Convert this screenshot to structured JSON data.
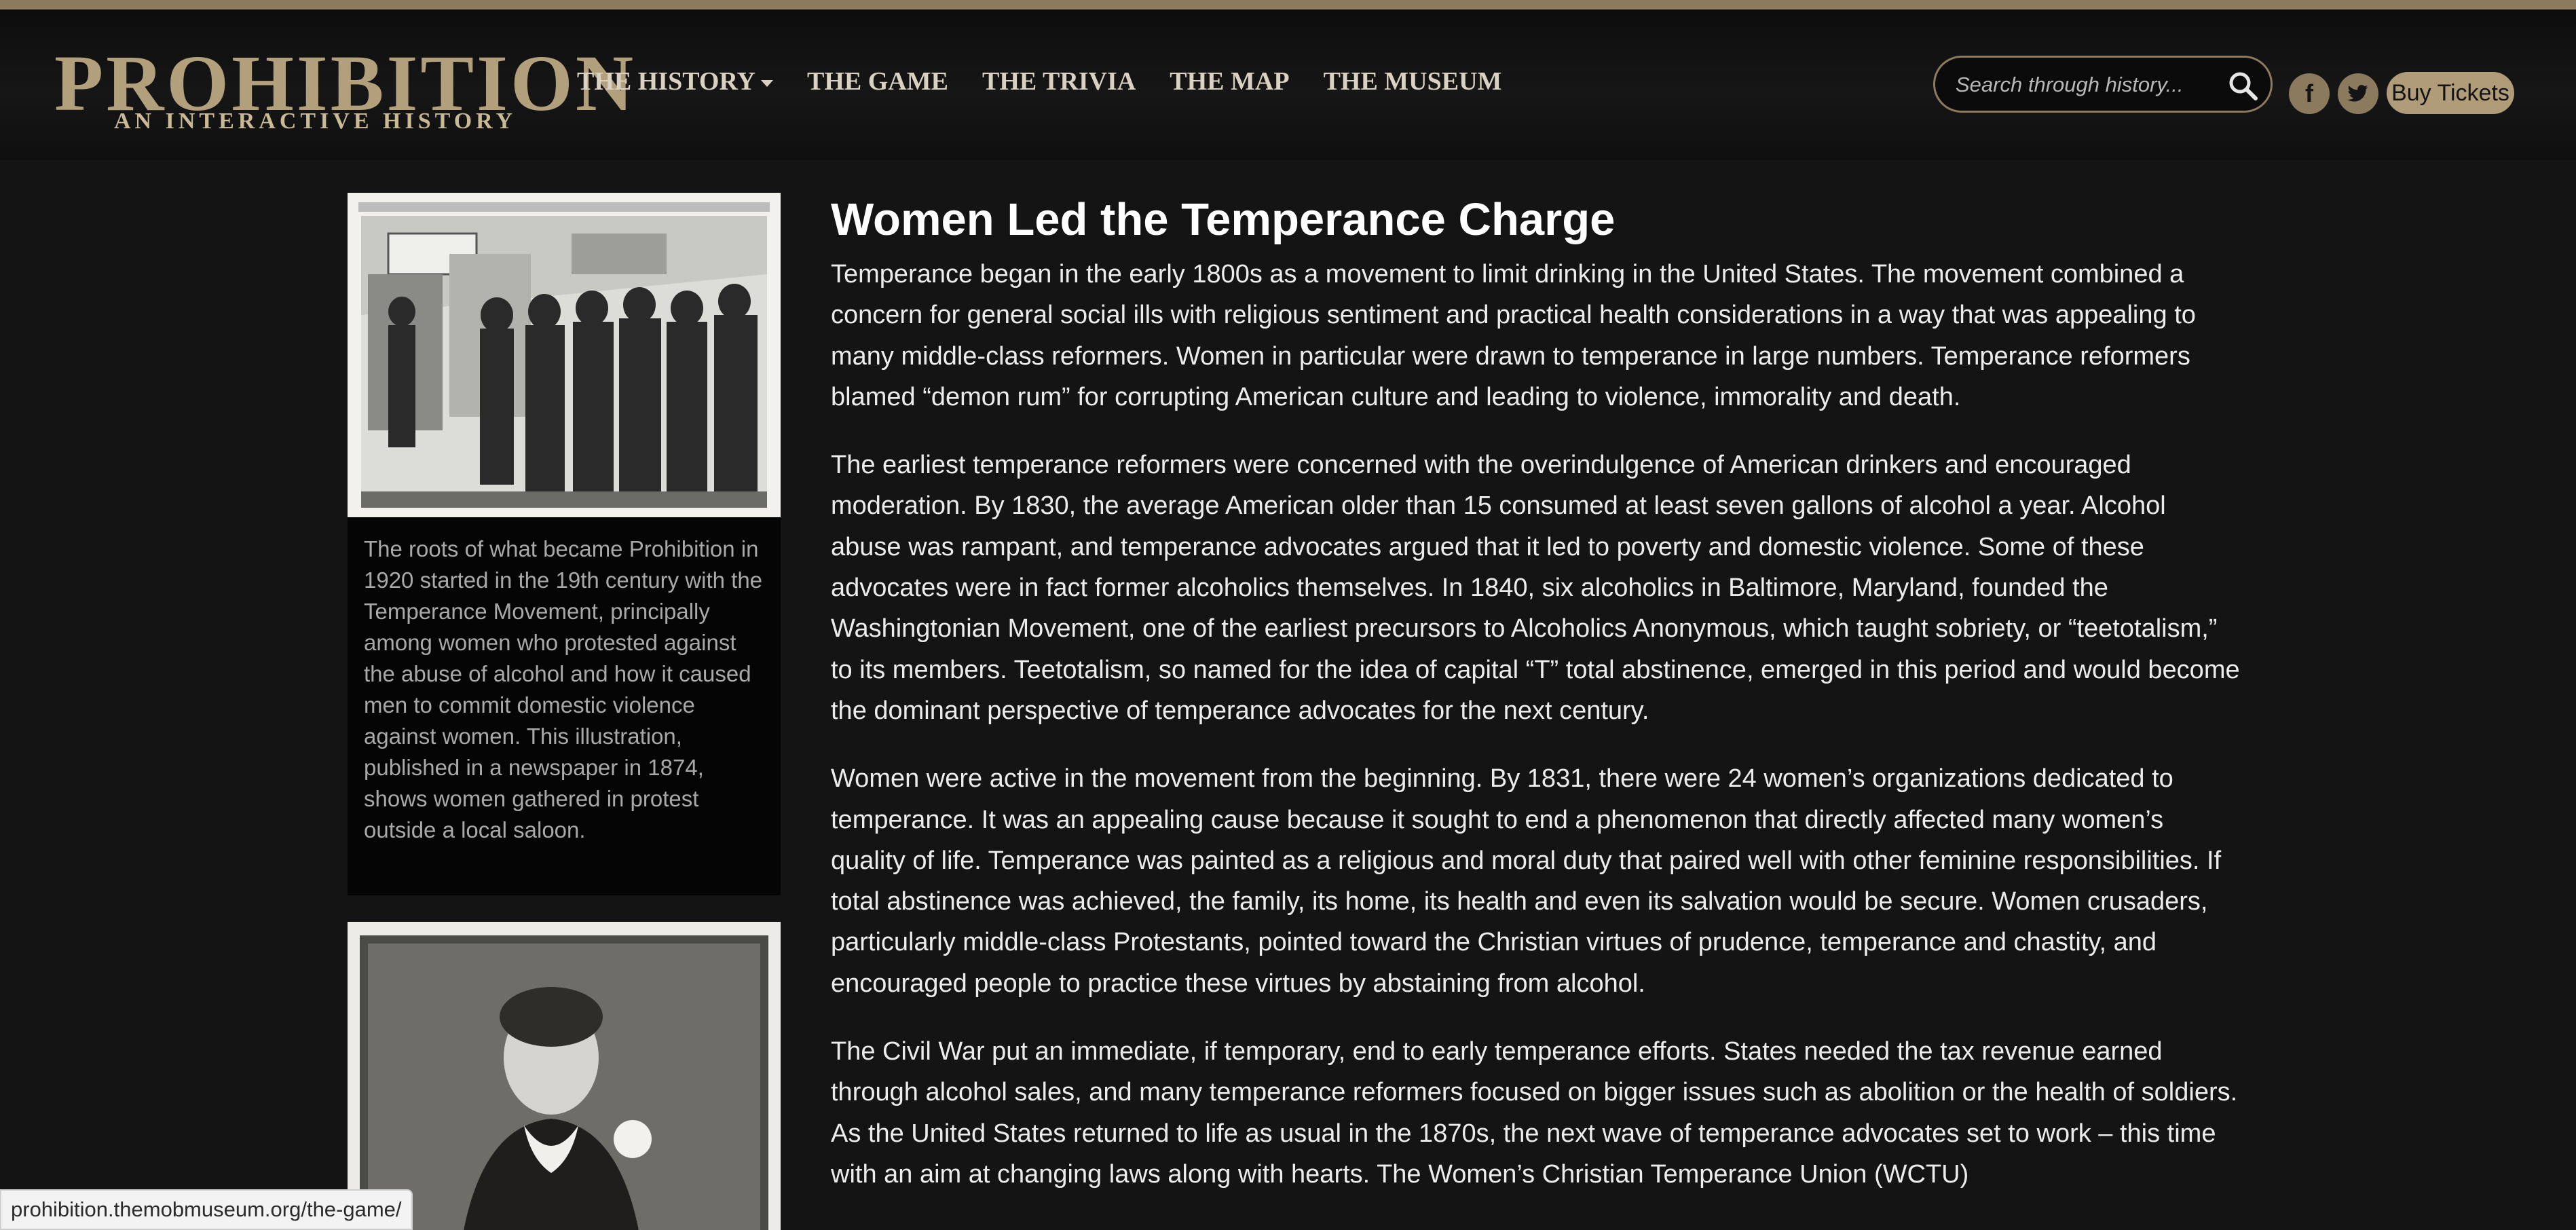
{
  "header": {
    "logo_main": "PROHIBITION",
    "logo_sub": "AN INTERACTIVE HISTORY",
    "nav": [
      {
        "label": "THE HISTORY",
        "dropdown": true
      },
      {
        "label": "THE GAME"
      },
      {
        "label": "THE TRIVIA"
      },
      {
        "label": "THE MAP"
      },
      {
        "label": "THE MUSEUM"
      }
    ],
    "search_placeholder": "Search through history...",
    "buy_tickets": "Buy Tickets",
    "social_icons": [
      "facebook-icon",
      "twitter-icon"
    ]
  },
  "sidebar": {
    "figure1_icon": "saloon-protest-illustration",
    "figure1_caption": "The roots of what became Prohibition in 1920 started in the 19th century with the Temperance Movement, principally among women who protested against the abuse of alcohol and how it caused men to commit domestic violence against women. This illustration, published in a newspaper in 1874, shows women gathered in protest outside a local saloon.",
    "figure2_icon": "carrie-nation-photo"
  },
  "article": {
    "title": "Women Led the Temperance Charge",
    "paragraphs": [
      "Temperance began in the early 1800s as a movement to limit drinking in the United States. The movement combined a concern for general social ills with religious sentiment and practical health considerations in a way that was appealing to many middle-class reformers. Women in particular were drawn to temperance in large numbers. Temperance reformers blamed “demon rum” for corrupting American culture and leading to violence, immorality and death.",
      "The earliest temperance reformers were concerned with the overindulgence of American drinkers and encouraged moderation. By 1830, the average American older than 15 consumed at least seven gallons of alcohol a year. Alcohol abuse was rampant, and temperance advocates argued that it led to poverty and domestic violence. Some of these advocates were in fact former alcoholics themselves. In 1840, six alcoholics in Baltimore, Maryland, founded the Washingtonian Movement, one of the earliest precursors to Alcoholics Anonymous, which taught sobriety, or “teetotalism,” to its members. Teetotalism, so named for the idea of capital “T” total abstinence, emerged in this period and would become the dominant perspective of temperance advocates for the next century.",
      "Women were active in the movement from the beginning. By 1831, there were 24 women’s organizations dedicated to temperance. It was an appealing cause because it sought to end a phenomenon that directly affected many women’s quality of life. Temperance was painted as a religious and moral duty that paired well with other feminine responsibilities. If total abstinence was achieved, the family, its home, its health and even its salvation would be secure. Women crusaders, particularly middle-class Protestants, pointed toward the Christian virtues of prudence, temperance and chastity, and encouraged people to practice these virtues by abstaining from alcohol.",
      "The Civil War put an immediate, if temporary, end to early temperance efforts. States needed the tax revenue earned through alcohol sales, and many temperance reformers focused on bigger issues such as abolition or the health of soldiers. As the United States returned to life as usual in the 1870s, the next wave of temperance advocates set to work – this time with an aim at changing laws along with hearts. The Women’s Christian Temperance Union (WCTU)"
    ]
  },
  "status_bar": {
    "url": "prohibition.themobmuseum.org/the-game/"
  },
  "colors": {
    "accent_gold": "#8c7a5e",
    "logo_gold": "#b29f7c",
    "background": "#141414"
  }
}
